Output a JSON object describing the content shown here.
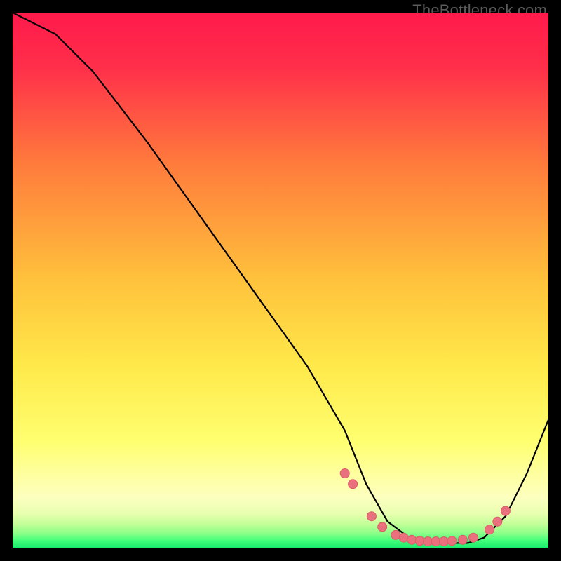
{
  "watermark": "TheBottleneck.com",
  "colors": {
    "frame": "#000000",
    "grad_top": "#ff1a4b",
    "grad_mid1": "#ff7a3c",
    "grad_mid2": "#ffd23a",
    "grad_mid3": "#ffff66",
    "grad_low1": "#f6ffb0",
    "grad_low2": "#c9ff9e",
    "grad_bottom": "#2bff7e",
    "curve": "#000000",
    "marker_fill": "#e9717d",
    "marker_stroke": "#de5a68"
  },
  "chart_data": {
    "type": "line",
    "title": "",
    "xlabel": "",
    "ylabel": "",
    "xlim": [
      0,
      100
    ],
    "ylim": [
      0,
      100
    ],
    "series": [
      {
        "name": "bottleneck-curve",
        "x": [
          0,
          8,
          15,
          25,
          35,
          45,
          55,
          62,
          66,
          70,
          74,
          78,
          82,
          85,
          88,
          92,
          96,
          100
        ],
        "y": [
          100,
          96,
          89,
          76,
          62,
          48,
          34,
          22,
          12,
          5,
          2,
          1,
          1,
          1,
          2,
          6,
          14,
          24
        ]
      }
    ],
    "markers": {
      "name": "highlighted-points",
      "x": [
        62,
        63.5,
        67,
        69,
        71.5,
        73,
        74.5,
        76,
        77.5,
        79,
        80.5,
        82,
        84,
        86,
        89,
        90.5,
        92
      ],
      "y": [
        14,
        12,
        6,
        4,
        2.5,
        2,
        1.6,
        1.4,
        1.3,
        1.3,
        1.3,
        1.4,
        1.6,
        2,
        3.5,
        5,
        7
      ]
    }
  }
}
